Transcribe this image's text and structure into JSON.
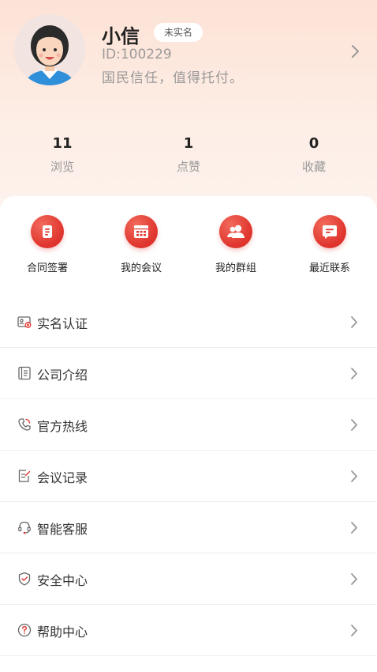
{
  "profile": {
    "name": "小信",
    "badge": "未实名",
    "id_text": "ID:100229",
    "motto": "国民信任，值得托付。"
  },
  "stats": [
    {
      "value": "11",
      "label": "浏览"
    },
    {
      "value": "1",
      "label": "点赞"
    },
    {
      "value": "0",
      "label": "收藏"
    }
  ],
  "quick_actions": [
    {
      "label": "合同签署",
      "icon": "document-icon"
    },
    {
      "label": "我的会议",
      "icon": "calendar-icon"
    },
    {
      "label": "我的群组",
      "icon": "group-icon"
    },
    {
      "label": "最近联系",
      "icon": "chat-icon"
    }
  ],
  "menu": [
    {
      "label": "实名认证",
      "icon": "id-card-icon"
    },
    {
      "label": "公司介绍",
      "icon": "company-doc-icon"
    },
    {
      "label": "官方热线",
      "icon": "phone-icon"
    },
    {
      "label": "会议记录",
      "icon": "notes-icon"
    },
    {
      "label": "智能客服",
      "icon": "headset-icon"
    },
    {
      "label": "安全中心",
      "icon": "shield-icon"
    },
    {
      "label": "帮助中心",
      "icon": "help-icon"
    }
  ],
  "colors": {
    "accent": "#e0362f",
    "header_bg": "#fde2d6"
  }
}
